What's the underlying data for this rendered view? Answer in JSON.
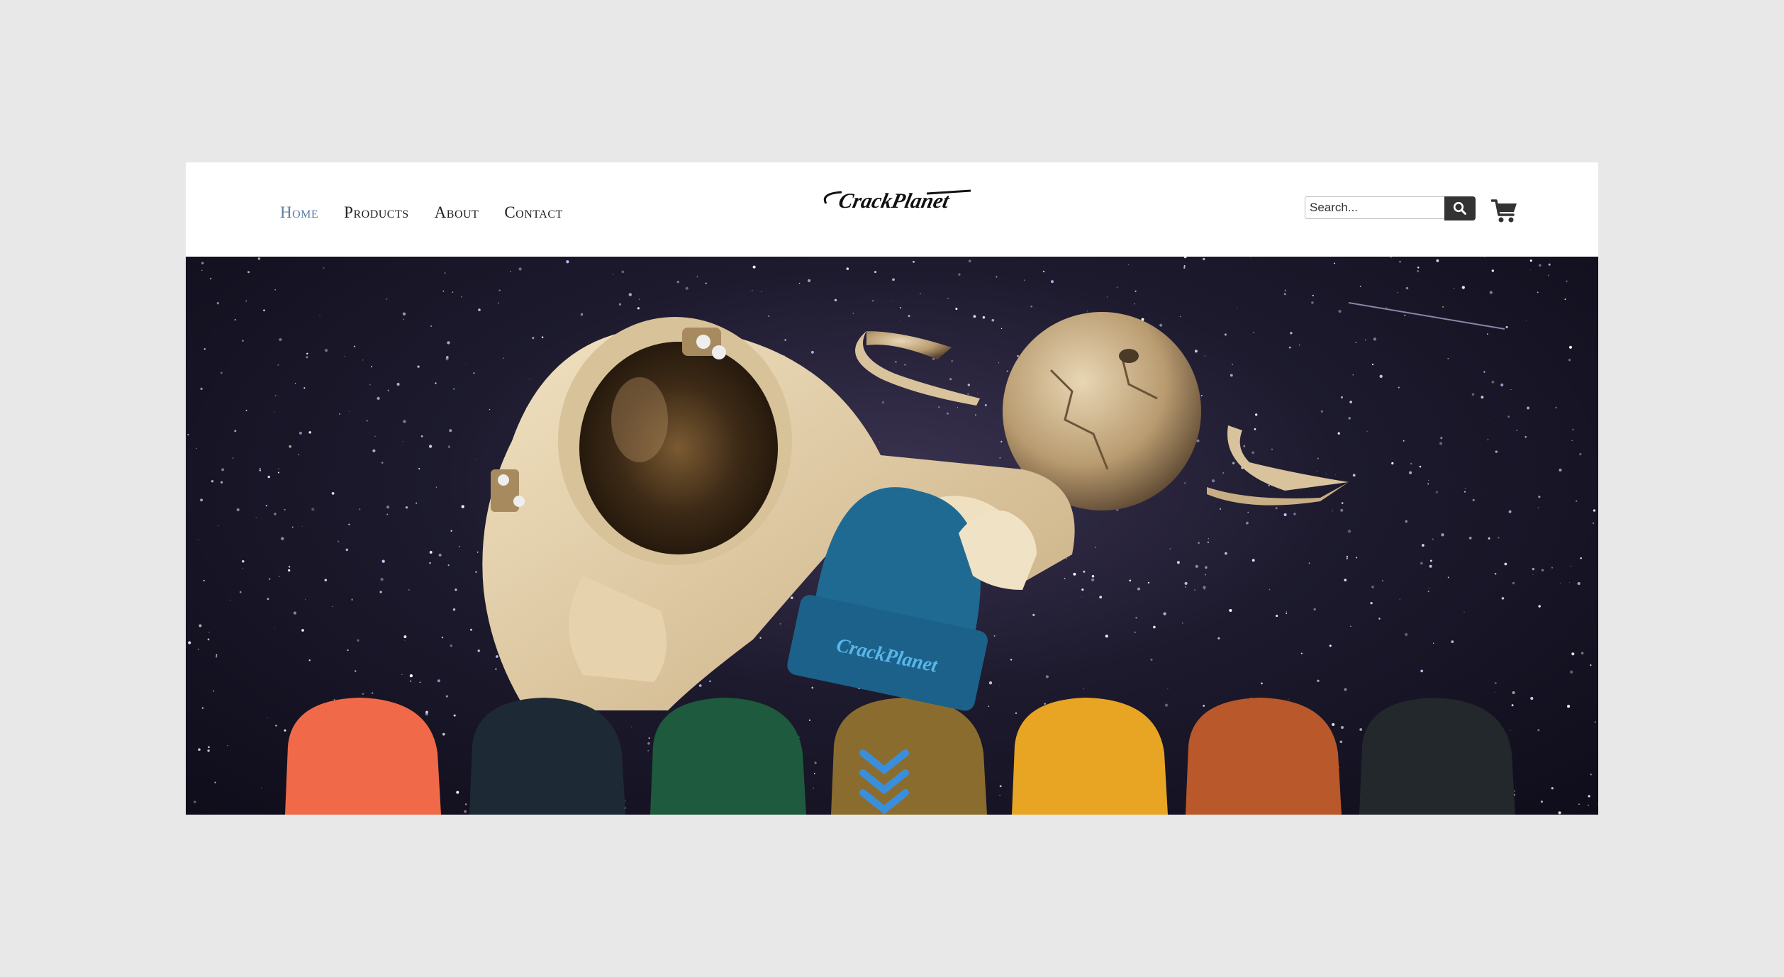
{
  "header": {
    "nav": [
      {
        "label": "Home",
        "active": true
      },
      {
        "label": "Products",
        "active": false
      },
      {
        "label": "About",
        "active": false
      },
      {
        "label": "Contact",
        "active": false
      }
    ],
    "logo_text": "CrackPlanet",
    "search": {
      "placeholder": "Search...",
      "value": ""
    },
    "icons": {
      "search": "search-icon",
      "cart": "cart-icon"
    }
  },
  "hero": {
    "description_icons": [
      "scroll-down-chevrons-icon"
    ],
    "beanie_colors": [
      "#f06a4a",
      "#1d2a36",
      "#1e5a3e",
      "#8a6d2e",
      "#e8a524",
      "#b9582b",
      "#22282b"
    ],
    "featured_beanie_color": "#1f6a93",
    "featured_beanie_logo": "CrackPlanet"
  },
  "colors": {
    "background": "#e8e8e8",
    "nav_active": "#5c7ea6",
    "search_button": "#333333"
  }
}
